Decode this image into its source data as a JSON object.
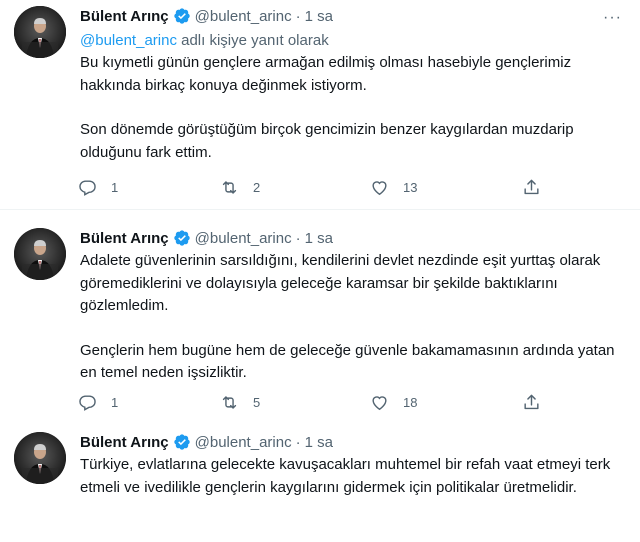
{
  "tweets": [
    {
      "author_name": "Bülent Arınç",
      "handle": "@bulent_arinc",
      "separator": "·",
      "time": "1 sa",
      "more_label": "···",
      "reply_to": {
        "mention": "@bulent_arinc",
        "suffix": " adlı kişiye yanıt olarak"
      },
      "paragraphs": [
        "Bu kıymetli günün gençlere armağan edilmiş olması hasebiyle gençlerimiz hakkında birkaç konuya değinmek istiyorm.",
        "Son dönemde görüştüğüm birçok gencimizin benzer kaygılardan muzdarip olduğunu fark ettim."
      ],
      "replies": "1",
      "retweets": "2",
      "likes": "13"
    },
    {
      "author_name": "Bülent Arınç",
      "handle": "@bulent_arinc",
      "separator": "·",
      "time": "1 sa",
      "paragraphs": [
        "Adalete güvenlerinin sarsıldığını, kendilerini devlet nezdinde eşit yurttaş olarak göremediklerini ve dolayısıyla geleceğe karamsar bir şekilde baktıklarını gözlemledim.",
        "Gençlerin hem bugüne hem de geleceğe güvenle bakamamasının ardında yatan en temel neden işsizliktir."
      ],
      "replies": "1",
      "retweets": "5",
      "likes": "18"
    },
    {
      "author_name": "Bülent Arınç",
      "handle": "@bulent_arinc",
      "separator": "·",
      "time": "1 sa",
      "paragraphs": [
        "Türkiye, evlatlarına gelecekte kavuşacakları muhtemel bir refah vaat etmeyi terk etmeli ve ivedilikle gençlerin kaygılarını gidermek için politikalar üretmelidir."
      ]
    }
  ],
  "colors": {
    "text": "#0f1419",
    "secondary": "#536471",
    "accent": "#1d9bf0",
    "divider": "#eff3f4"
  },
  "icons": {
    "verified": "verified-badge-icon",
    "reply": "reply-icon",
    "retweet": "retweet-icon",
    "like": "heart-icon",
    "share": "share-icon",
    "more": "more-icon"
  }
}
